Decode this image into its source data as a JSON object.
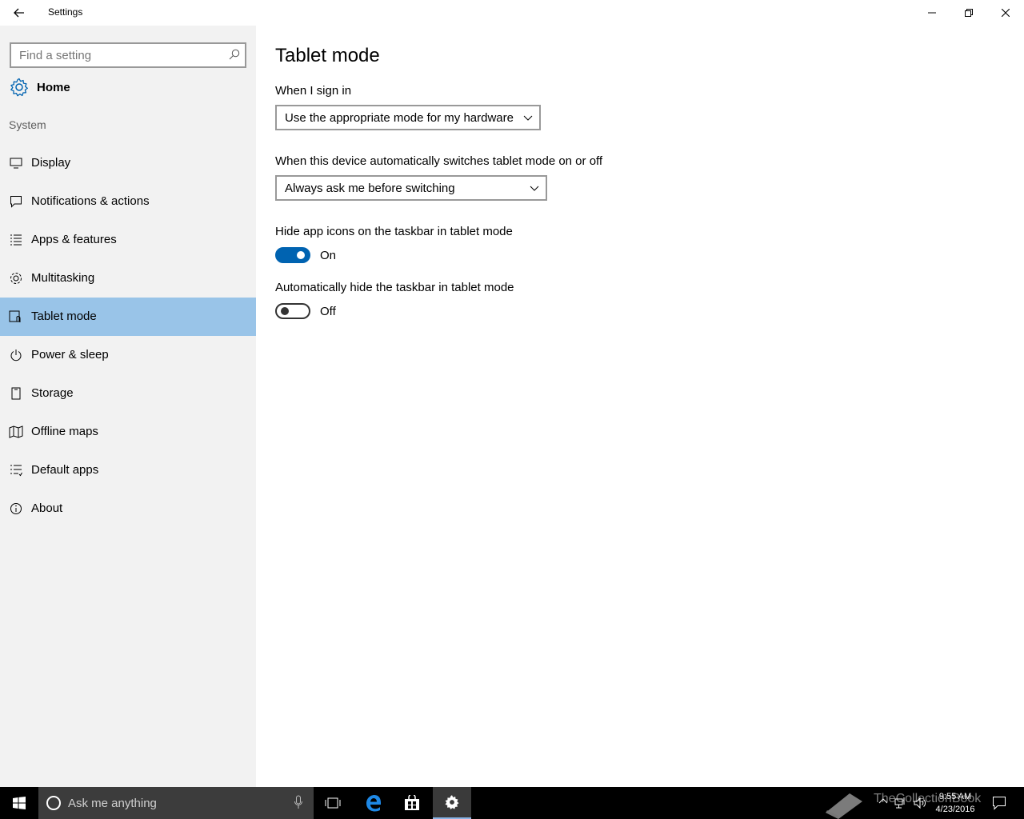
{
  "window": {
    "title": "Settings"
  },
  "sidebar": {
    "search_placeholder": "Find a setting",
    "home_label": "Home",
    "section_label": "System",
    "items": [
      {
        "label": "Display",
        "icon": "monitor-icon"
      },
      {
        "label": "Notifications & actions",
        "icon": "message-icon"
      },
      {
        "label": "Apps & features",
        "icon": "list-icon"
      },
      {
        "label": "Multitasking",
        "icon": "multitask-icon"
      },
      {
        "label": "Tablet mode",
        "icon": "tablet-icon",
        "selected": true
      },
      {
        "label": "Power & sleep",
        "icon": "power-icon"
      },
      {
        "label": "Storage",
        "icon": "storage-icon"
      },
      {
        "label": "Offline maps",
        "icon": "map-icon"
      },
      {
        "label": "Default apps",
        "icon": "default-apps-icon"
      },
      {
        "label": "About",
        "icon": "info-icon"
      }
    ]
  },
  "main": {
    "title": "Tablet mode",
    "sign_in": {
      "label": "When I sign in",
      "value": "Use the appropriate mode for my hardware"
    },
    "auto_switch": {
      "label": "When this device automatically switches tablet mode on or off",
      "value": "Always ask me before switching"
    },
    "hide_icons": {
      "label": "Hide app icons on the taskbar in tablet mode",
      "state": "On",
      "on": true
    },
    "hide_taskbar": {
      "label": "Automatically hide the taskbar in tablet mode",
      "state": "Off",
      "on": false
    }
  },
  "taskbar": {
    "search_placeholder": "Ask me anything",
    "time": "9:55 AM",
    "date": "4/23/2016",
    "watermark": "TheCollectionBook"
  },
  "colors": {
    "accent": "#0063b1",
    "selected_nav": "#99c4e8",
    "sidebar_bg": "#f2f2f2",
    "taskbar_bg": "#000000"
  }
}
